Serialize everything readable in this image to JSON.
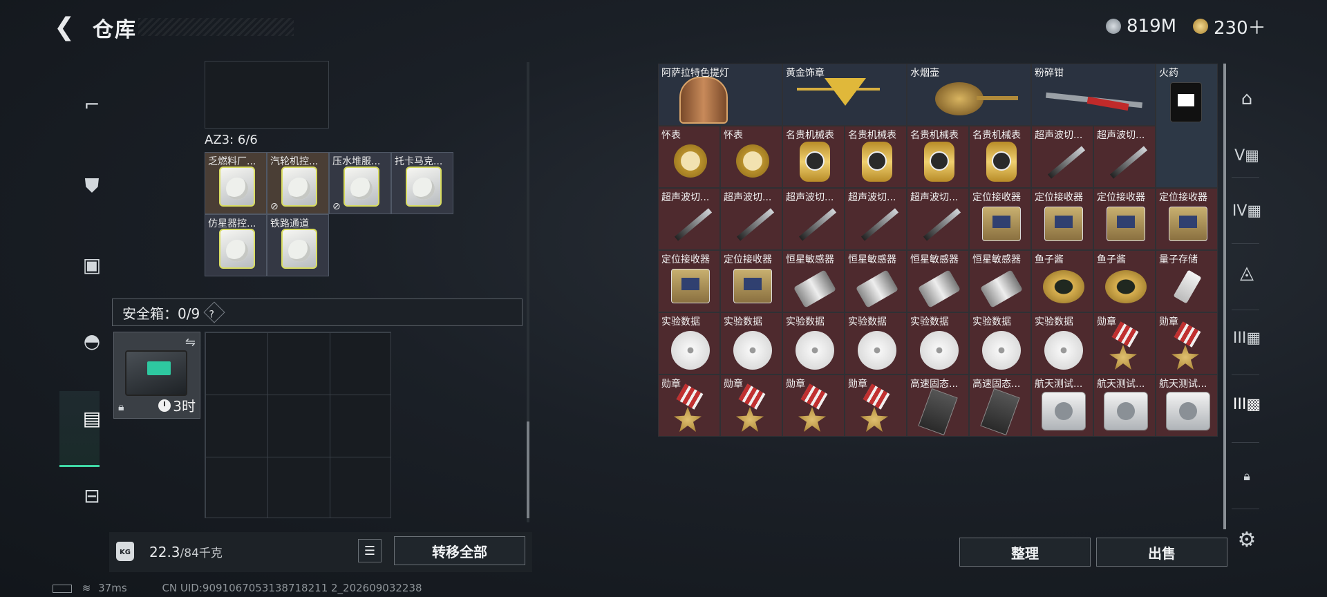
{
  "header": {
    "back_icon": "back-arrow-icon",
    "title": "仓库",
    "currency": [
      {
        "icon": "silver-coin-icon",
        "value": "819M",
        "color": "#9aa4ad"
      },
      {
        "icon": "gold-coin-icon",
        "value": "230＋",
        "color": "#c9a34a"
      }
    ]
  },
  "left_rail": {
    "items": [
      "pistol-icon",
      "vest-icon",
      "backpack-icon",
      "helmet-bag-icon",
      "safebox-icon",
      "toolbox-icon"
    ],
    "active": "safebox-icon"
  },
  "container": {
    "label": "AZ3: 6/6",
    "items": [
      {
        "name": "乏燃料厂...",
        "locked": false
      },
      {
        "name": "汽轮机控...",
        "locked": true
      },
      {
        "name": "压水堆服...",
        "locked": true
      },
      {
        "name": "托卡马克...",
        "locked": false
      },
      {
        "name": "仿星器控...",
        "locked": false
      },
      {
        "name": "铁路通道",
        "locked": false
      }
    ]
  },
  "safe_box": {
    "label": "安全箱：0/9",
    "help": "?",
    "timer": "3时",
    "swap_icon": "swap-icon",
    "lock_icon": "lock-icon",
    "clock_icon": "clock-icon"
  },
  "weight": {
    "current": "22.3",
    "max": "/84千克",
    "kg_icon": "kg-weight-icon",
    "list_icon": "list-icon",
    "transfer_all": "转移全部"
  },
  "storage": {
    "rows": [
      [
        {
          "name": "阿萨拉特色提灯",
          "pic": "lantern",
          "bg": "#2a3240",
          "span": 2
        },
        {
          "name": "黄金饰章",
          "pic": "badge",
          "bg": "#2a3240",
          "span": 2
        },
        {
          "name": "水烟壶",
          "pic": "hookah",
          "bg": "#2a3240",
          "span": 2
        },
        {
          "name": "粉碎钳",
          "pic": "pliers",
          "bg": "#2a3240",
          "span": 2
        },
        {
          "name": "火药",
          "pic": "powder",
          "bg": "#2d3846",
          "span": 1
        }
      ],
      [
        {
          "name": "怀表",
          "pic": "watch",
          "bg": "#4e2a2e"
        },
        {
          "name": "怀表",
          "pic": "watch",
          "bg": "#4e2a2e"
        },
        {
          "name": "名贵机械表",
          "pic": "wristwatch",
          "bg": "#4e2a2e"
        },
        {
          "name": "名贵机械表",
          "pic": "wristwatch",
          "bg": "#4e2a2e"
        },
        {
          "name": "名贵机械表",
          "pic": "wristwatch",
          "bg": "#4e2a2e"
        },
        {
          "name": "名贵机械表",
          "pic": "wristwatch",
          "bg": "#4e2a2e"
        },
        {
          "name": "超声波切...",
          "pic": "knife",
          "bg": "#4e2a2e"
        },
        {
          "name": "超声波切...",
          "pic": "knife",
          "bg": "#4e2a2e"
        }
      ],
      [
        {
          "name": "超声波切...",
          "pic": "knife",
          "bg": "#4e2a2e"
        },
        {
          "name": "超声波切...",
          "pic": "knife",
          "bg": "#4e2a2e"
        },
        {
          "name": "超声波切...",
          "pic": "knife",
          "bg": "#4e2a2e"
        },
        {
          "name": "超声波切...",
          "pic": "knife",
          "bg": "#4e2a2e"
        },
        {
          "name": "超声波切...",
          "pic": "knife",
          "bg": "#4e2a2e"
        },
        {
          "name": "定位接收器",
          "pic": "receiver",
          "bg": "#4e2a2e"
        },
        {
          "name": "定位接收器",
          "pic": "receiver",
          "bg": "#4e2a2e"
        },
        {
          "name": "定位接收器",
          "pic": "receiver",
          "bg": "#4e2a2e"
        },
        {
          "name": "定位接收器",
          "pic": "receiver",
          "bg": "#4e2a2e"
        }
      ],
      [
        {
          "name": "定位接收器",
          "pic": "receiver",
          "bg": "#4e2a2e"
        },
        {
          "name": "定位接收器",
          "pic": "receiver",
          "bg": "#4e2a2e"
        },
        {
          "name": "恒星敏感器",
          "pic": "sensor",
          "bg": "#4e2a2e"
        },
        {
          "name": "恒星敏感器",
          "pic": "sensor",
          "bg": "#4e2a2e"
        },
        {
          "name": "恒星敏感器",
          "pic": "sensor",
          "bg": "#4e2a2e"
        },
        {
          "name": "恒星敏感器",
          "pic": "sensor",
          "bg": "#4e2a2e"
        },
        {
          "name": "鱼子酱",
          "pic": "caviar",
          "bg": "#4e2a2e"
        },
        {
          "name": "鱼子酱",
          "pic": "caviar",
          "bg": "#4e2a2e"
        },
        {
          "name": "量子存储",
          "pic": "usb",
          "bg": "#4e2a2e"
        }
      ],
      [
        {
          "name": "实验数据",
          "pic": "disc",
          "bg": "#4e2a2e"
        },
        {
          "name": "实验数据",
          "pic": "disc",
          "bg": "#4e2a2e"
        },
        {
          "name": "实验数据",
          "pic": "disc",
          "bg": "#4e2a2e"
        },
        {
          "name": "实验数据",
          "pic": "disc",
          "bg": "#4e2a2e"
        },
        {
          "name": "实验数据",
          "pic": "disc",
          "bg": "#4e2a2e"
        },
        {
          "name": "实验数据",
          "pic": "disc",
          "bg": "#4e2a2e"
        },
        {
          "name": "实验数据",
          "pic": "disc",
          "bg": "#4e2a2e"
        },
        {
          "name": "勋章",
          "pic": "medal",
          "bg": "#4e2a2e"
        },
        {
          "name": "勋章",
          "pic": "medal",
          "bg": "#4e2a2e"
        }
      ],
      [
        {
          "name": "勋章",
          "pic": "medal",
          "bg": "#4e2a2e"
        },
        {
          "name": "勋章",
          "pic": "medal",
          "bg": "#4e2a2e"
        },
        {
          "name": "勋章",
          "pic": "medal",
          "bg": "#4e2a2e"
        },
        {
          "name": "勋章",
          "pic": "medal",
          "bg": "#4e2a2e"
        },
        {
          "name": "高速固态...",
          "pic": "ssd",
          "bg": "#4e2a2e"
        },
        {
          "name": "高速固态...",
          "pic": "ssd",
          "bg": "#4e2a2e"
        },
        {
          "name": "航天测试...",
          "pic": "device",
          "bg": "#4e2a2e"
        },
        {
          "name": "航天测试...",
          "pic": "device",
          "bg": "#4e2a2e"
        },
        {
          "name": "航天测试...",
          "pic": "device",
          "bg": "#4e2a2e"
        }
      ]
    ],
    "sort_label": "整理",
    "sell_label": "出售"
  },
  "right_rail": {
    "items": [
      "helmet-slot-icon",
      "armor-v-icon",
      "armor-iv-icon",
      "bag-slot-icon",
      "armor-iii-icon",
      "armor-iii-b-icon",
      "lock-icon"
    ],
    "settings_icon": "gear-icon"
  },
  "status": {
    "ping": "37ms",
    "uid": "CN UID:9091067053138718211 2_202609032238"
  }
}
